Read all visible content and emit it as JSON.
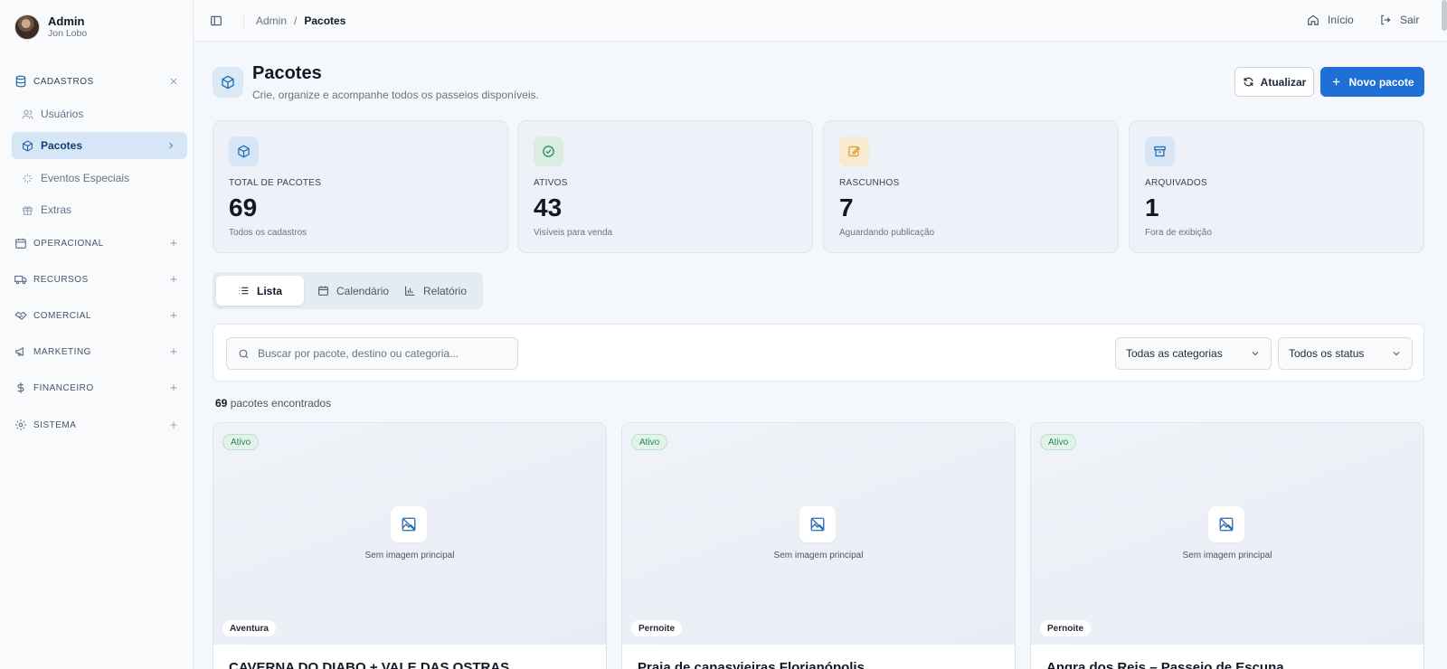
{
  "user": {
    "name": "Admin",
    "subtitle": "Jon Lobo"
  },
  "sidebar": {
    "groups": [
      {
        "label": "CADASTROS",
        "icon": "database-icon",
        "action": "close"
      },
      {
        "label": "OPERACIONAL",
        "icon": "calendar-icon",
        "action": "plus"
      },
      {
        "label": "RECURSOS",
        "icon": "truck-icon",
        "action": "plus"
      },
      {
        "label": "COMERCIAL",
        "icon": "handshake-icon",
        "action": "plus"
      },
      {
        "label": "MARKETING",
        "icon": "megaphone-icon",
        "action": "plus"
      },
      {
        "label": "FINANCEIRO",
        "icon": "dollar-icon",
        "action": "plus"
      },
      {
        "label": "SISTEMA",
        "icon": "gear-icon",
        "action": "plus"
      }
    ],
    "items": [
      {
        "label": "Usuários",
        "icon": "users-icon"
      },
      {
        "label": "Pacotes",
        "icon": "package-icon",
        "active": true
      },
      {
        "label": "Eventos Especiais",
        "icon": "sparkles-icon"
      },
      {
        "label": "Extras",
        "icon": "gift-icon"
      }
    ]
  },
  "topbar": {
    "breadcrumb_root": "Admin",
    "breadcrumb_sep": "/",
    "breadcrumb_current": "Pacotes",
    "home_label": "Início",
    "logout_label": "Sair"
  },
  "header": {
    "title": "Pacotes",
    "subtitle": "Crie, organize e acompanhe todos os passeios disponíveis.",
    "refresh_label": "Atualizar",
    "new_label": "Novo pacote"
  },
  "stats": [
    {
      "label": "TOTAL DE PACOTES",
      "value": "69",
      "desc": "Todos os cadastros",
      "icon": "package-icon",
      "color": "#1d6cb5"
    },
    {
      "label": "ATIVOS",
      "value": "43",
      "desc": "Visíveis para venda",
      "icon": "check-circle-icon",
      "color": "#23865a"
    },
    {
      "label": "RASCUNHOS",
      "value": "7",
      "desc": "Aguardando publicação",
      "icon": "edit-icon",
      "color": "#e0a030"
    },
    {
      "label": "ARQUIVADOS",
      "value": "1",
      "desc": "Fora de exibição",
      "icon": "archive-icon",
      "color": "#1d6cb5"
    }
  ],
  "tabs": [
    {
      "label": "Lista",
      "icon": "list-icon",
      "active": true
    },
    {
      "label": "Calendário",
      "icon": "calendar-icon"
    },
    {
      "label": "Relatório",
      "icon": "bar-chart-icon"
    }
  ],
  "filters": {
    "search_placeholder": "Buscar por pacote, destino ou categoria...",
    "category_value": "Todas as categorias",
    "status_value": "Todos os status"
  },
  "results": {
    "count": "69",
    "suffix": " pacotes encontrados"
  },
  "packages": [
    {
      "status": "Ativo",
      "no_image": "Sem imagem principal",
      "category": "Aventura",
      "title": "CAVERNA DO DIABO + VALE DAS OSTRAS"
    },
    {
      "status": "Ativo",
      "no_image": "Sem imagem principal",
      "category": "Pernoite",
      "title": "Praia de canasvieiras Florianópolis"
    },
    {
      "status": "Ativo",
      "no_image": "Sem imagem principal",
      "category": "Pernoite",
      "title": "Angra dos Reis – Passeio de Escuna"
    }
  ]
}
